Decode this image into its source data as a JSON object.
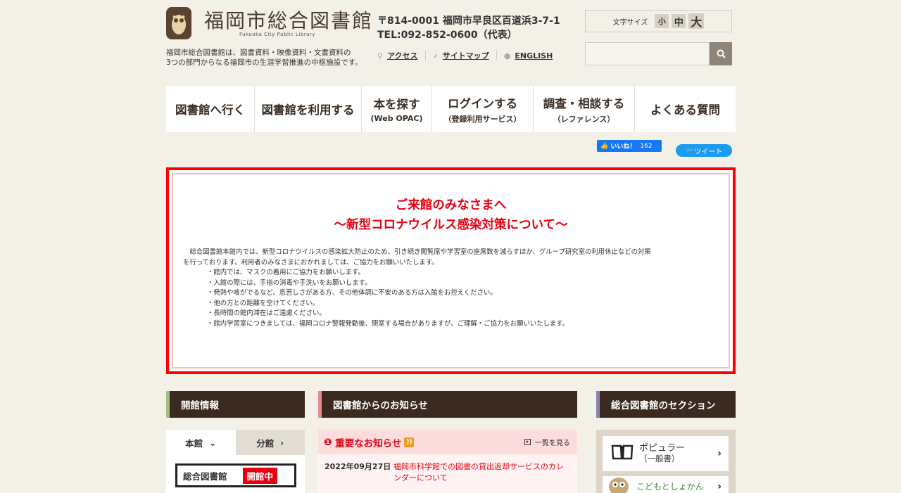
{
  "header": {
    "logo_title": "福岡市総合図書館",
    "logo_subtitle": "Fukuoka City Public Library",
    "description_line1": "福岡市総合図書館は、図書資料・映像資料・文書資料の",
    "description_line2": "3つの部門からなる福岡市の生涯学習推進の中枢施設です。",
    "address": "〒814-0001 福岡市早良区百道浜3-7-1",
    "tel": "TEL:092-852-0600（代表）",
    "links": [
      {
        "label": "アクセス",
        "icon": "map-pin-icon"
      },
      {
        "label": "サイトマップ",
        "icon": "sitemap-icon"
      },
      {
        "label": "ENGLISH",
        "icon": "globe-icon"
      }
    ],
    "font_size_label": "文字サイズ",
    "font_sizes": [
      "小",
      "中",
      "大"
    ],
    "search_placeholder": ""
  },
  "nav": [
    {
      "main": "図書館へ行く",
      "sub": ""
    },
    {
      "main": "図書館を利用する",
      "sub": ""
    },
    {
      "main": "本を探す",
      "sub": "(Web OPAC)"
    },
    {
      "main": "ログインする",
      "sub": "（登録利用サービス）"
    },
    {
      "main": "調査・相談する",
      "sub": "（レファレンス）"
    },
    {
      "main": "よくある質問",
      "sub": ""
    }
  ],
  "social": {
    "like_label": "いいね！",
    "like_count": "162",
    "tweet_label": "ツイート"
  },
  "notice": {
    "title1": "ご来館のみなさまへ",
    "title2": "～新型コロナウイルス感染対策について～",
    "para1": "　総合図書館本館内では、新型コロナウイルスの感染拡大防止のため、引き続き閲覧席や学習室の座席数を減らすほか、グループ研究室の利用休止などの対策",
    "para2": "を行っております。利用者のみなさまにおかれましては、ご協力をお願いいたします。",
    "bullets": [
      "・館内では、マスクの着用にご協力をお願いします。",
      "・入館の際には、手指の消毒や手洗いをお願いします。",
      "・発熱や咳がでるなど、息苦しさがある方、その他体調に不安のある方は入館をお控えください。",
      "・他の方との距離を空けてください。",
      "・長時間の館内滞在はご遠慮ください。",
      "・館内学習室につきましては、福岡コロナ警報発動後、閉室する場合がありますが、ご理解・ご協力をお願いいたします。"
    ]
  },
  "sections": {
    "opening_info": "開館情報",
    "news": "図書館からのお知らせ",
    "library_sections": "総合図書館のセクション"
  },
  "opening": {
    "tabs": [
      "本館",
      "分館"
    ],
    "library_name": "総合図書館",
    "status": "開館中"
  },
  "news": {
    "heading": "重要なお知らせ",
    "more": "一覧を見る",
    "items": [
      {
        "date": "2022年09月27日",
        "title": "福岡市科学館での図書の貸出返却サービスのカレンダーについて"
      }
    ]
  },
  "library_sections": {
    "items": [
      {
        "label": "ポピュラー",
        "sub": "（一般書）"
      },
      {
        "label": "こどもとしょかん",
        "sub": ""
      }
    ]
  },
  "colors": {
    "accent_red": "#e60012",
    "header_brown": "#3a2a20",
    "background": "#f3f0e8"
  }
}
